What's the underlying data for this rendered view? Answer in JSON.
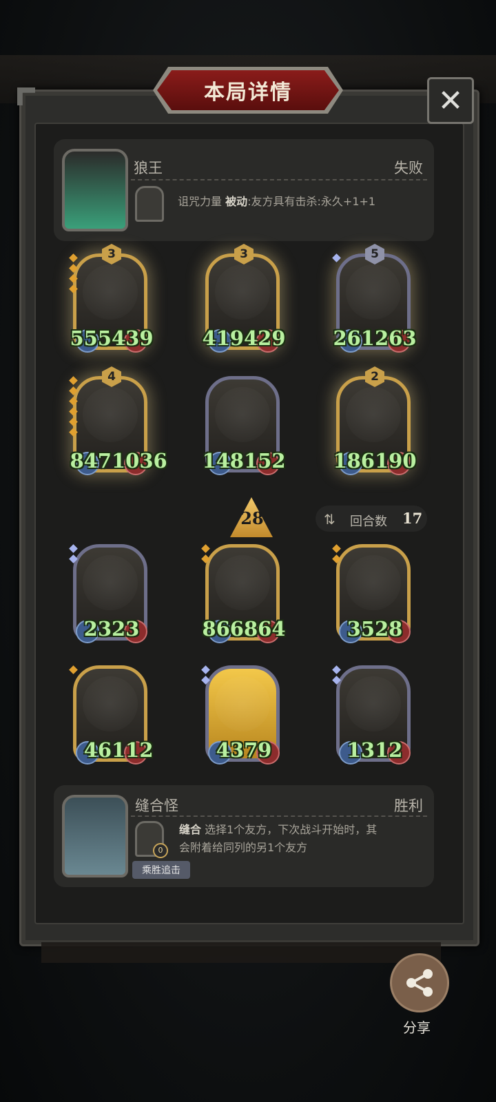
{
  "title": "本局详情",
  "close_icon": "close-icon",
  "opponent": {
    "name": "狼王",
    "result": "失败",
    "skill_name": "诅咒力量",
    "skill_type": "被动",
    "skill_desc": ":友方具有击杀:永久+1+1"
  },
  "opponent_units": [
    {
      "level": "3",
      "atk": "555",
      "hp": "439",
      "frame": "gold",
      "pips": 4
    },
    {
      "level": "3",
      "atk": "419",
      "hp": "429",
      "frame": "gold",
      "pips": 0
    },
    {
      "level": "5",
      "atk": "261",
      "hp": "263",
      "frame": "silver",
      "pips": 1
    },
    {
      "level": "4",
      "atk": "847",
      "hp": "1036",
      "frame": "gold",
      "pips": 6
    },
    {
      "level": "",
      "atk": "148",
      "hp": "152",
      "frame": "silver",
      "pips": 0
    },
    {
      "level": "2",
      "atk": "186",
      "hp": "190",
      "frame": "gold",
      "pips": 0
    }
  ],
  "gold_value": "28",
  "round": {
    "label": "回合数",
    "value": "17"
  },
  "player_units": [
    {
      "atk": "23",
      "hp": "23",
      "frame": "silver",
      "pips": 2
    },
    {
      "atk": "866",
      "hp": "864",
      "frame": "gold",
      "pips": 2
    },
    {
      "atk": "35",
      "hp": "28",
      "frame": "gold",
      "pips": 2
    },
    {
      "atk": "46",
      "hp": "112",
      "frame": "gold",
      "pips": 1
    },
    {
      "atk": "43",
      "hp": "79",
      "frame": "silver",
      "pips": 2
    },
    {
      "atk": "13",
      "hp": "12",
      "frame": "silver",
      "pips": 2
    }
  ],
  "player": {
    "name": "缝合怪",
    "result": "胜利",
    "skill_name": "缝合",
    "skill_desc_line1": "选择1个友方，下次战斗开始时，其",
    "skill_desc_line2": "会附着给同列的另1个友方",
    "skill_counter": "0",
    "tag": "乘胜追击"
  },
  "share_label": "分享"
}
